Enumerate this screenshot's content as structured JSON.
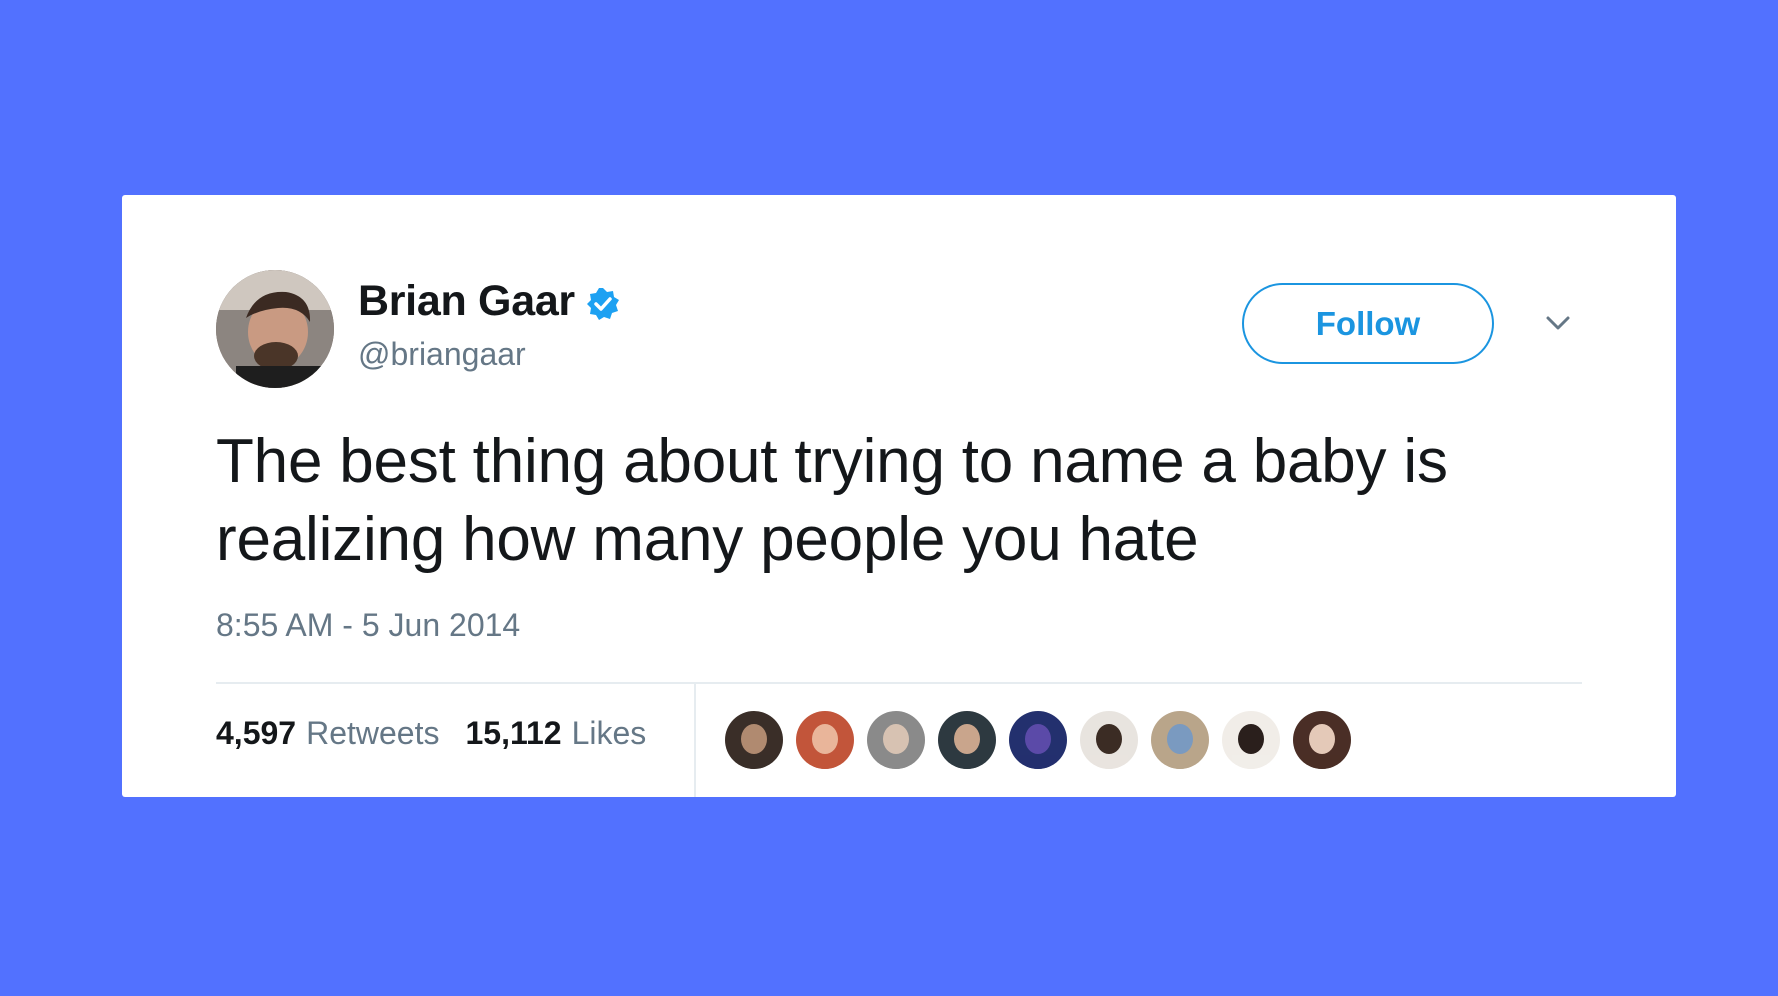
{
  "tweet": {
    "author": {
      "display_name": "Brian Gaar",
      "handle": "@briangaar",
      "verified": true
    },
    "follow_label": "Follow",
    "text": "The best thing about trying to name a baby is realizing how many people you hate",
    "timestamp": "8:55 AM - 5 Jun 2014",
    "retweets": {
      "count": "4,597",
      "label": "Retweets"
    },
    "likes": {
      "count": "15,112",
      "label": "Likes"
    },
    "likers": [
      {
        "bg": "#3a2e28",
        "face": "#b08a70"
      },
      {
        "bg": "#c2553a",
        "face": "#e9b59a"
      },
      {
        "bg": "#8a8a8a",
        "face": "#d7c2b2"
      },
      {
        "bg": "#2d3940",
        "face": "#c9a58c"
      },
      {
        "bg": "#23306e",
        "face": "#5b4aa8"
      },
      {
        "bg": "#e8e4df",
        "face": "#3b2c24"
      },
      {
        "bg": "#b9a58a",
        "face": "#7a9ac0"
      },
      {
        "bg": "#f1ede8",
        "face": "#2a1f1c"
      },
      {
        "bg": "#4a2e26",
        "face": "#e4c9b8"
      }
    ]
  },
  "colors": {
    "background": "#5271ff",
    "card": "#ffffff",
    "accent": "#1b95e0",
    "text": "#14171a",
    "muted": "#657786"
  }
}
